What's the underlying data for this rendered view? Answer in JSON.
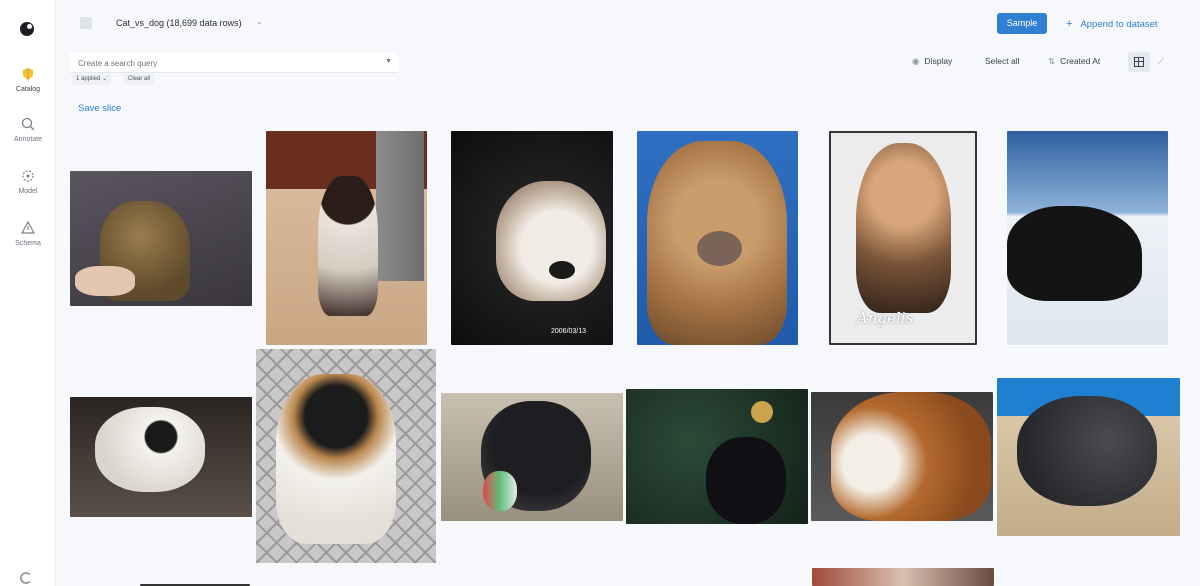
{
  "sidebar": {
    "items": [
      {
        "label": "Catalog",
        "icon": "catalog-icon",
        "active": true
      },
      {
        "label": "Annotate",
        "icon": "annotate-icon"
      },
      {
        "label": "Model",
        "icon": "model-icon"
      },
      {
        "label": "Schema",
        "icon": "schema-icon"
      }
    ]
  },
  "header": {
    "dataset_name": "Cat_vs_dog (18,699 data rows)",
    "sample_label": "Sample",
    "append_label": "Append to dataset"
  },
  "search": {
    "placeholder": "Create a search query",
    "filter_chip": "1 applied ⌄",
    "clear_chip": "Clear all"
  },
  "save_slice_label": "Save slice",
  "toolbar": {
    "display_label": "Display",
    "select_all_label": "Select all",
    "sort_label": "Created At"
  },
  "colors": {
    "accent": "#2f7fd3",
    "background": "#f6f8fb"
  },
  "gallery": {
    "caption_angelis": "Angelis",
    "date_stamp": "2006/03/13"
  }
}
